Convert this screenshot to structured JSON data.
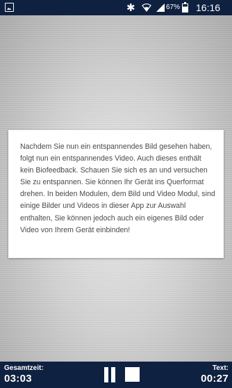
{
  "status_bar": {
    "battery_percent": "67%",
    "time": "16:16",
    "icons": [
      "notification-image-icon",
      "bluetooth-icon",
      "wifi-icon",
      "signal-icon",
      "battery-icon"
    ]
  },
  "card": {
    "text": "Nachdem Sie nun ein entspannendes Bild gesehen haben, folgt nun ein entspannendes Video. Auch dieses enthält kein Biofeedback. Schauen Sie sich es an und versuchen Sie zu entspannen. Sie können Ihr Gerät ins Querformat drehen. In beiden Modulen, dem Bild und Video Modul, sind einige Bilder und Videos in dieser App zur Auswahl enthalten, Sie können jedoch auch ein eigenes Bild oder Video von Ihrem Gerät einbinden!"
  },
  "bottom_bar": {
    "total_label": "Gesamtzeit:",
    "total_value": "03:03",
    "text_label": "Text:",
    "text_value": "00:27",
    "controls": [
      "pause-icon",
      "stop-icon"
    ]
  },
  "colors": {
    "bar_background": "#0f2140",
    "card_background": "#ffffff",
    "card_text": "#4a4a4a"
  }
}
